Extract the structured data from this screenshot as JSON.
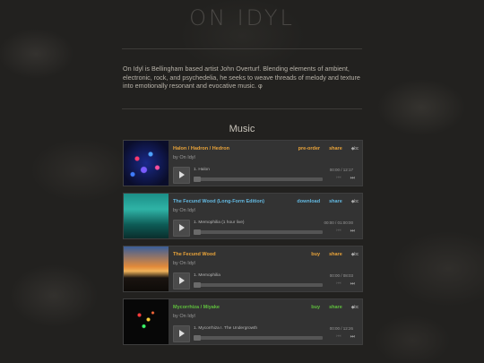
{
  "site": {
    "title": "ON IDYL",
    "bio": "On Idyl is Bellingham based artist John Overturf. Blending elements of ambient, electronic, rock, and psychedelia, he seeks to weave threads of melody and texture into emotionally resonant and evocative music. φ"
  },
  "music": {
    "heading": "Music",
    "players": [
      {
        "title": "Halon / Hadron / Hedron",
        "artist": "by On Idyl",
        "action": "pre-order",
        "share": "share",
        "bc": "◆bc",
        "track": "1.  Halon",
        "time": "00:00 / 12:17",
        "accent": "#e8a33a",
        "art": "blue-particles"
      },
      {
        "title": "The Fecund Wood (Long-Form Edition)",
        "artist": "by On Idyl",
        "action": "download",
        "share": "share",
        "bc": "◆bc",
        "track": "1.  Memophilia (1 hour live)",
        "time": "00:00 / 01:00:00",
        "accent": "#63b8e0",
        "art": "teal-forest"
      },
      {
        "title": "The Fecund Wood",
        "artist": "by On Idyl",
        "action": "buy",
        "share": "share",
        "bc": "◆bc",
        "track": "1.  Memophilia",
        "time": "00:00 / 08:03",
        "accent": "#e8a33a",
        "art": "sunset-forest"
      },
      {
        "title": "Mycorrhiza / Miyake",
        "artist": "by On Idyl",
        "action": "buy",
        "share": "share",
        "bc": "◆bc",
        "track": "1.  Mycorrhiza I. The Undergrowth",
        "time": "00:00 / 12:26",
        "accent": "#5fbf3d",
        "art": "dark-lights"
      }
    ]
  }
}
